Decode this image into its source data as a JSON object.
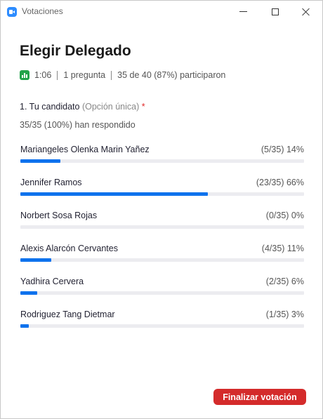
{
  "window": {
    "title": "Votaciones"
  },
  "poll": {
    "title": "Elegir Delegado",
    "duration": "1:06",
    "question_count": "1 pregunta",
    "participation": "35 de 40 (87%) participaron"
  },
  "question": {
    "label": "1. Tu candidato",
    "type": "(Opción única)",
    "required_mark": "*",
    "answered": "35/35 (100%) han respondido"
  },
  "options": [
    {
      "name": "Mariangeles Olenka Marin Yañez",
      "stat": "(5/35) 14%",
      "percent": 14
    },
    {
      "name": "Jennifer Ramos",
      "stat": "(23/35) 66%",
      "percent": 66
    },
    {
      "name": "Norbert Sosa Rojas",
      "stat": "(0/35) 0%",
      "percent": 0
    },
    {
      "name": "Alexis Alarcón Cervantes",
      "stat": "(4/35) 11%",
      "percent": 11
    },
    {
      "name": "Yadhira Cervera",
      "stat": "(2/35) 6%",
      "percent": 6
    },
    {
      "name": "Rodriguez Tang Dietmar",
      "stat": "(1/35) 3%",
      "percent": 3
    }
  ],
  "actions": {
    "end_poll": "Finalizar votación"
  },
  "colors": {
    "accent": "#0E72ED",
    "app_icon": "#2D8CFF",
    "poll_icon": "#22A34A",
    "danger": "#D42B2B"
  }
}
